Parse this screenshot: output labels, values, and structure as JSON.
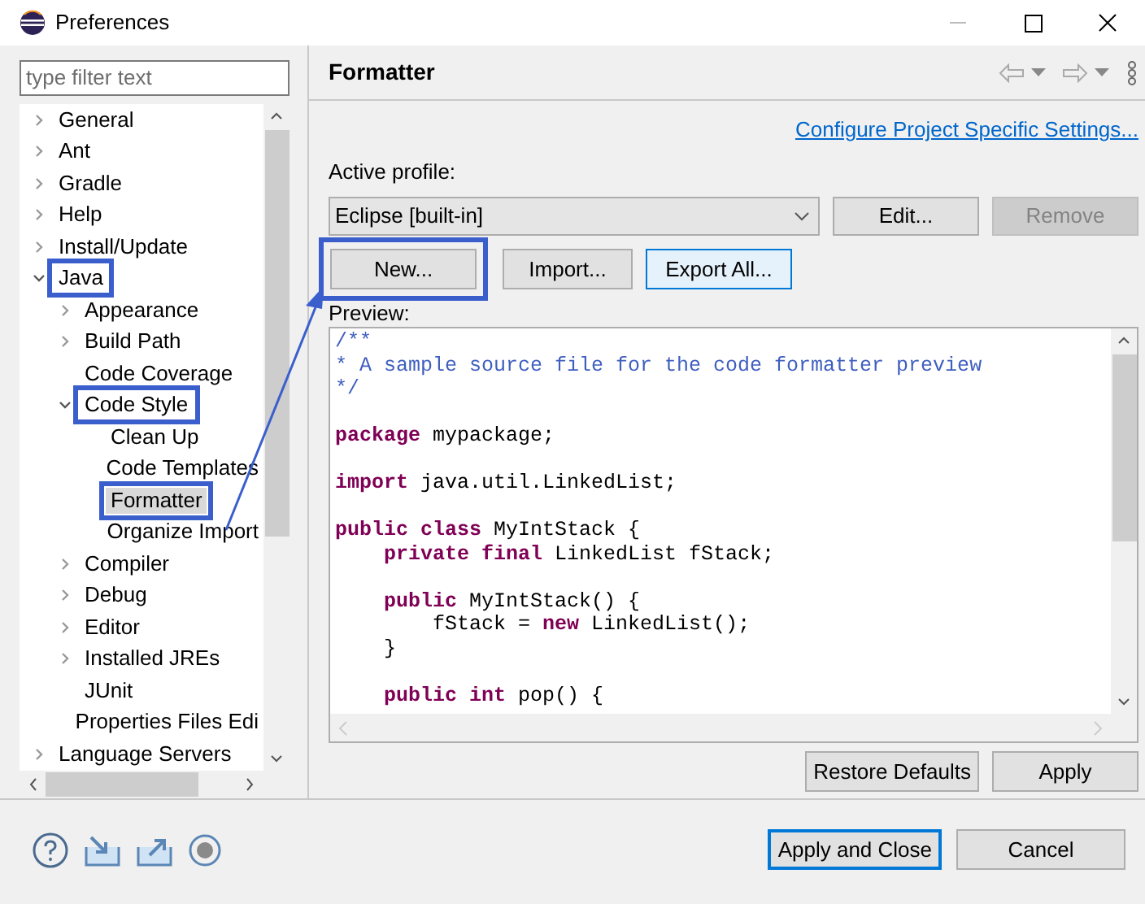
{
  "window": {
    "title": "Preferences"
  },
  "filter": {
    "placeholder": "type filter text"
  },
  "tree": [
    {
      "label": "General",
      "expanded": false,
      "selected": false,
      "highlighted": false
    },
    {
      "label": "Ant",
      "expanded": false,
      "selected": false,
      "highlighted": false
    },
    {
      "label": "Gradle",
      "expanded": false,
      "selected": false,
      "highlighted": false
    },
    {
      "label": "Help",
      "expanded": false,
      "selected": false,
      "highlighted": false
    },
    {
      "label": "Install/Update",
      "expanded": false,
      "selected": false,
      "highlighted": false
    },
    {
      "label": "Java",
      "expanded": true,
      "selected": false,
      "highlighted": true,
      "children": [
        {
          "label": "Appearance",
          "expanded": false,
          "selected": false,
          "highlighted": false
        },
        {
          "label": "Build Path",
          "expanded": false,
          "selected": false,
          "highlighted": false
        },
        {
          "label": "Code Coverage",
          "selected": false,
          "highlighted": false
        },
        {
          "label": "Code Style",
          "expanded": true,
          "selected": false,
          "highlighted": true,
          "children": [
            {
              "label": "Clean Up",
              "selected": false,
              "highlighted": false
            },
            {
              "label": "Code Templates",
              "selected": false,
              "highlighted": false
            },
            {
              "label": "Formatter",
              "selected": true,
              "highlighted": true
            },
            {
              "label": "Organize Import",
              "selected": false,
              "highlighted": false
            }
          ]
        },
        {
          "label": "Compiler",
          "expanded": false,
          "selected": false,
          "highlighted": false
        },
        {
          "label": "Debug",
          "expanded": false,
          "selected": false,
          "highlighted": false
        },
        {
          "label": "Editor",
          "expanded": false,
          "selected": false,
          "highlighted": false
        },
        {
          "label": "Installed JREs",
          "expanded": false,
          "selected": false,
          "highlighted": false
        },
        {
          "label": "JUnit",
          "selected": false,
          "highlighted": false
        },
        {
          "label": "Properties Files Edi",
          "selected": false,
          "highlighted": false
        }
      ]
    },
    {
      "label": "Language Servers",
      "expanded": false,
      "selected": false,
      "highlighted": false
    }
  ],
  "page": {
    "title": "Formatter",
    "link": "Configure Project Specific Settings...",
    "profile_label": "Active profile:",
    "profile_value": "Eclipse [built-in]",
    "profile_buttons": [
      {
        "label": "Edit...",
        "disabled": false
      },
      {
        "label": "Remove",
        "disabled": true
      }
    ],
    "actions": [
      {
        "label": "New...",
        "focused": false,
        "highlighted": true
      },
      {
        "label": "Import...",
        "focused": false,
        "highlighted": false
      },
      {
        "label": "Export All...",
        "focused": true,
        "highlighted": false
      }
    ],
    "preview_label": "Preview:",
    "preview_lines": [
      {
        "kind": "code",
        "tokens": [
          {
            "text": "/**",
            "kind": "comment"
          }
        ]
      },
      {
        "kind": "code",
        "tokens": [
          {
            "text": "* A sample source file for the code formatter preview",
            "kind": "comment"
          }
        ]
      },
      {
        "kind": "code",
        "tokens": [
          {
            "text": "*/",
            "kind": "comment"
          }
        ]
      },
      {
        "kind": "blank"
      },
      {
        "kind": "code",
        "tokens": [
          {
            "text": "package",
            "kind": "keyword"
          },
          {
            "text": " mypackage;",
            "kind": "plain"
          }
        ]
      },
      {
        "kind": "blank"
      },
      {
        "kind": "code",
        "tokens": [
          {
            "text": "import",
            "kind": "keyword"
          },
          {
            "text": " java.util.LinkedList;",
            "kind": "plain"
          }
        ]
      },
      {
        "kind": "blank"
      },
      {
        "kind": "code",
        "tokens": [
          {
            "text": "public class",
            "kind": "keyword"
          },
          {
            "text": " MyIntStack {",
            "kind": "plain"
          }
        ]
      },
      {
        "kind": "code",
        "tokens": [
          {
            "text": "    private final",
            "kind": "keyword"
          },
          {
            "text": " LinkedList fStack;",
            "kind": "plain"
          }
        ]
      },
      {
        "kind": "blank"
      },
      {
        "kind": "code",
        "tokens": [
          {
            "text": "    public",
            "kind": "keyword"
          },
          {
            "text": " MyIntStack() {",
            "kind": "plain"
          }
        ]
      },
      {
        "kind": "code",
        "tokens": [
          {
            "text": "        fStack = ",
            "kind": "plain"
          },
          {
            "text": "new",
            "kind": "keyword"
          },
          {
            "text": " LinkedList();",
            "kind": "plain"
          }
        ]
      },
      {
        "kind": "code",
        "tokens": [
          {
            "text": "    }",
            "kind": "plain"
          }
        ]
      },
      {
        "kind": "blank"
      },
      {
        "kind": "code",
        "tokens": [
          {
            "text": "    public int",
            "kind": "keyword"
          },
          {
            "text": " pop() {",
            "kind": "plain"
          }
        ]
      }
    ],
    "page_buttons": [
      "Restore Defaults",
      "Apply"
    ]
  },
  "footer_buttons": [
    {
      "label": "Apply and Close",
      "default": true
    },
    {
      "label": "Cancel",
      "default": false
    }
  ]
}
